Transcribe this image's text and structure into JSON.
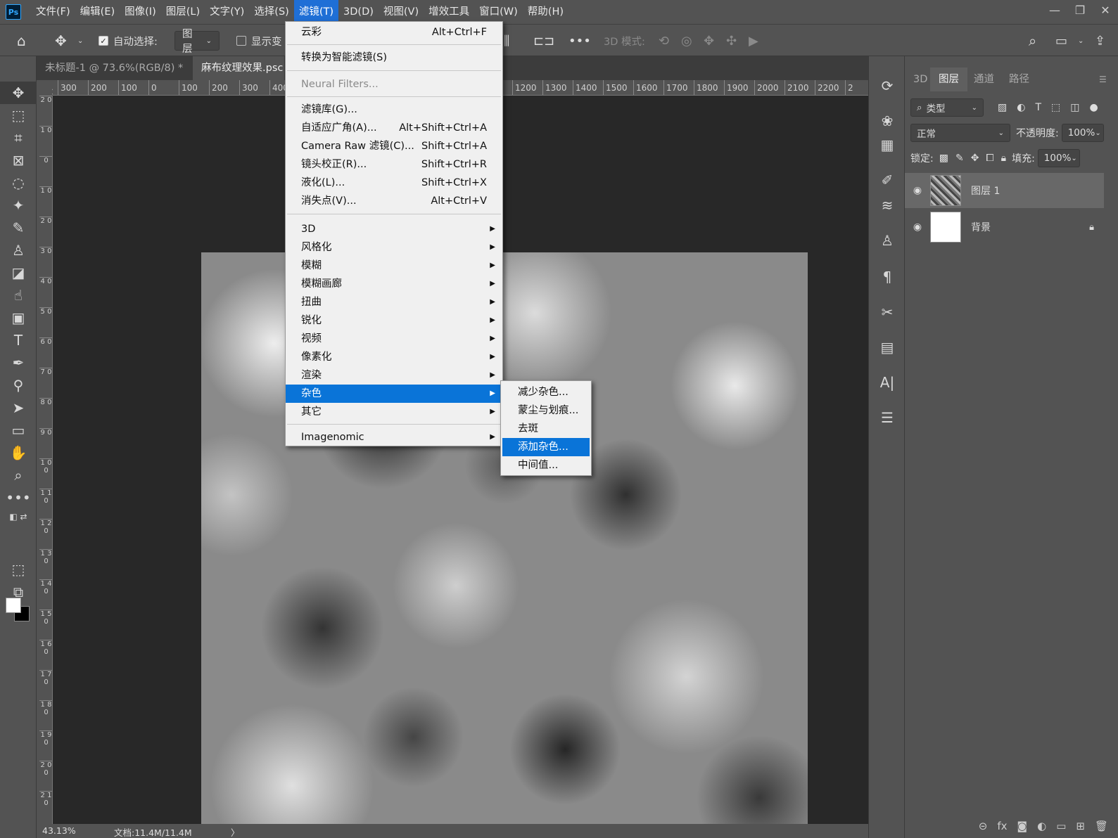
{
  "menubar": {
    "logo": "Ps",
    "items": [
      "文件(F)",
      "编辑(E)",
      "图像(I)",
      "图层(L)",
      "文字(Y)",
      "选择(S)",
      "滤镜(T)",
      "3D(D)",
      "视图(V)",
      "增效工具",
      "窗口(W)",
      "帮助(H)"
    ],
    "active_index": 6
  },
  "window_controls": {
    "minimize": "—",
    "restore": "❐",
    "close": "✕"
  },
  "options": {
    "auto_select_label": "自动选择:",
    "auto_select_value": "图层",
    "show_transform_label": "显示变",
    "mode_3d_label": "3D 模式:"
  },
  "tabs": [
    {
      "label": "未标题-1 @ 73.6%(RGB/8) *",
      "close": "×"
    },
    {
      "label": "麻布纹理效果.psc"
    }
  ],
  "ruler_h": [
    "300",
    "200",
    "100",
    "0",
    "100",
    "200",
    "300",
    "400",
    "1200",
    "1300",
    "1400",
    "1500",
    "1600",
    "1700",
    "1800",
    "1900",
    "2000",
    "2100",
    "2200",
    "2"
  ],
  "ruler_v": [
    "2 0",
    "1 0",
    "0",
    "1 0",
    "2 0",
    "3 0",
    "4 0",
    "5 0",
    "6 0",
    "7 0",
    "8 0",
    "9 0",
    "1 0 0",
    "1 1 0",
    "1 2 0",
    "1 3 0",
    "1 4 0",
    "1 5 0",
    "1 6 0",
    "1 7 0",
    "1 8 0",
    "1 9 0",
    "2 0 0",
    "2 1 0"
  ],
  "filter_menu": {
    "items": [
      {
        "label": "云彩",
        "shortcut": "Alt+Ctrl+F"
      },
      {
        "label": "转换为智能滤镜(S)"
      },
      {
        "label": "Neural Filters...",
        "disabled": true
      },
      {
        "label": "滤镜库(G)..."
      },
      {
        "label": "自适应广角(A)...",
        "shortcut": "Alt+Shift+Ctrl+A"
      },
      {
        "label": "Camera Raw 滤镜(C)...",
        "shortcut": "Shift+Ctrl+A"
      },
      {
        "label": "镜头校正(R)...",
        "shortcut": "Shift+Ctrl+R"
      },
      {
        "label": "液化(L)...",
        "shortcut": "Shift+Ctrl+X"
      },
      {
        "label": "消失点(V)...",
        "shortcut": "Alt+Ctrl+V"
      },
      {
        "label": "3D"
      },
      {
        "label": "风格化"
      },
      {
        "label": "模糊"
      },
      {
        "label": "模糊画廊"
      },
      {
        "label": "扭曲"
      },
      {
        "label": "锐化"
      },
      {
        "label": "视频"
      },
      {
        "label": "像素化"
      },
      {
        "label": "渲染"
      },
      {
        "label": "杂色",
        "highlighted": true
      },
      {
        "label": "其它"
      },
      {
        "label": "Imagenomic"
      }
    ]
  },
  "noise_submenu": {
    "items": [
      "减少杂色...",
      "蒙尘与划痕...",
      "去斑",
      "添加杂色...",
      "中间值..."
    ],
    "highlighted_index": 3
  },
  "layers_panel": {
    "tabs": [
      "3D",
      "图层",
      "通道",
      "路径"
    ],
    "active_tab": 1,
    "filter_label": "类型",
    "blend_mode": "正常",
    "opacity_label": "不透明度:",
    "opacity_value": "100%",
    "lock_label": "锁定:",
    "fill_label": "填充:",
    "fill_value": "100%",
    "layers": [
      {
        "name": "图层 1",
        "selected": true
      },
      {
        "name": "背景",
        "locked": true
      }
    ],
    "footer_fx": "fx"
  },
  "status": {
    "zoom": "43.13%",
    "doc": "文档:11.4M/11.4M",
    "arrow": "〉"
  }
}
